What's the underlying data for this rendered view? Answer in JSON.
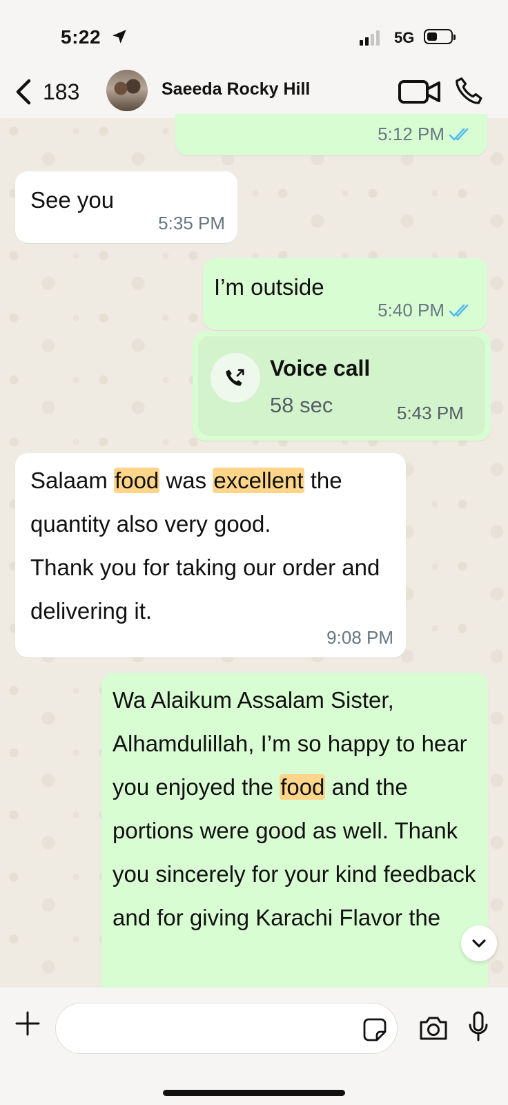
{
  "status_bar": {
    "time": "5:22",
    "network": "5G"
  },
  "header": {
    "back_count": "183",
    "contact_name": "Saeeda Rocky Hill"
  },
  "messages": [
    {
      "direction": "out",
      "text": "",
      "time": "5:12 PM",
      "read": true
    },
    {
      "direction": "in",
      "text": "See you",
      "time": "5:35 PM"
    },
    {
      "direction": "out",
      "text": "I’m outside",
      "time": "5:40 PM",
      "read": true
    },
    {
      "direction": "out",
      "type": "call",
      "title": "Voice call",
      "duration": "58 sec",
      "time": "5:43 PM"
    },
    {
      "direction": "in",
      "parts": [
        "Salaam ",
        "food",
        " was ",
        "excellent",
        " the quantity also very good.",
        "Thank you for taking our order and delivering it."
      ],
      "time": "9:08 PM"
    },
    {
      "direction": "out",
      "parts": [
        "Wa Alaikum Assalam Sister, Alhamdulillah, I’m so happy to hear you enjoyed the ",
        "food",
        " and the portions were good as well. Thank you sincerely for your kind feedback and for giving Karachi Flavor the"
      ]
    }
  ],
  "highlight_color": "#ffd58a",
  "composer": {
    "placeholder": ""
  },
  "colors": {
    "incoming_bubble": "#ffffff",
    "outgoing_bubble": "#d9fdd3",
    "read_ticks": "#53bdeb"
  },
  "icons": [
    "location-arrow-icon",
    "back-chevron-icon",
    "video-call-icon",
    "phone-icon",
    "outgoing-call-icon",
    "double-check-icon",
    "chevron-down-icon",
    "plus-icon",
    "sticker-icon",
    "camera-icon",
    "microphone-icon"
  ]
}
